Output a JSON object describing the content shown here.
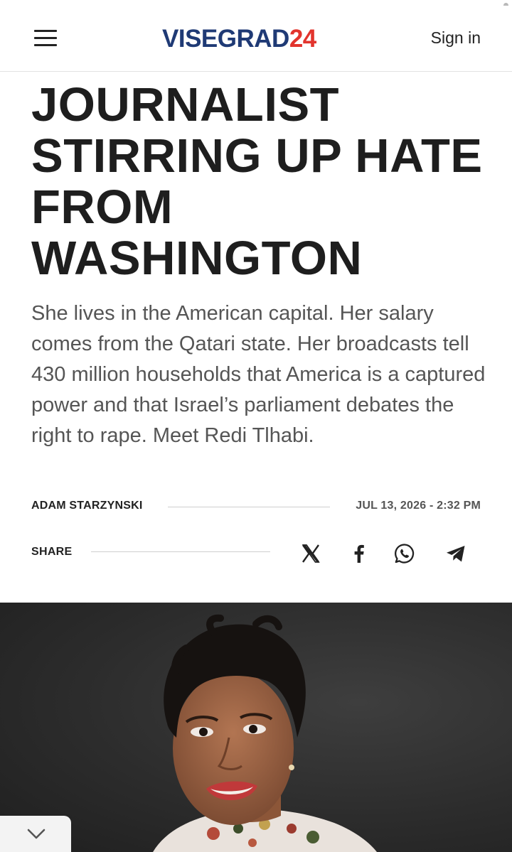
{
  "header": {
    "logo_part_a": "VISEGRAD",
    "logo_part_b": "24",
    "signin_label": "Sign in",
    "menu_icon": "hamburger-menu-icon"
  },
  "article": {
    "headline": "JOURNALIST STIRRING UP HATE FROM WASHINGTON",
    "lead": "She lives in the American capital. Her salary comes from the Qatari state. Her broadcasts tell 430 million households that America is a captured power and that Israel’s parliament debates the right to rape. Meet Redi Tlhabi.",
    "author": "ADAM STARZYNSKI",
    "date": "JUL 13, 2026 - 2:32 PM"
  },
  "share": {
    "label": "SHARE",
    "icons": [
      "x-icon",
      "facebook-icon",
      "whatsapp-icon",
      "telegram-icon"
    ]
  },
  "colors": {
    "logo_blue": "#1f3a75",
    "logo_red": "#e2342d",
    "text_dark": "#1e1e1e",
    "text_grey": "#555555"
  }
}
